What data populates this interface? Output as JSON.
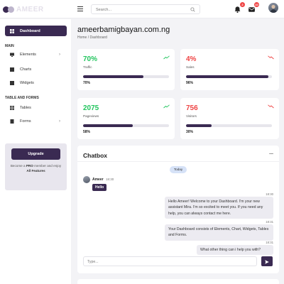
{
  "header": {
    "logo_text": "AMEER",
    "search_placeholder": "Search...",
    "notifications_count": "2",
    "messages_count": "10"
  },
  "sidebar": {
    "dashboard_label": "Dashboard",
    "main_section": "MAIN",
    "elements_label": "Elements",
    "charts_label": "Charts",
    "widgets_label": "Widgets",
    "tables_forms_section": "TABLE AND FORMS",
    "tables_label": "Tables",
    "forms_label": "Forms",
    "upgrade_button": "Upgrade",
    "upgrade_text_1": "Become a",
    "upgrade_text_pro": "PRO",
    "upgrade_text_2": "member and enjoy",
    "upgrade_text_all": "All Features"
  },
  "page": {
    "title": "ameerbamigbayan.com.ng",
    "breadcrumb": "Home / Dashboard"
  },
  "stats": [
    {
      "value": "70%",
      "label": "Traffic",
      "percent_label": "70%",
      "progress": 0.7,
      "trend": "up",
      "color": "#22c55e"
    },
    {
      "value": "4%",
      "label": "Sales",
      "percent_label": "96%",
      "progress": 0.96,
      "trend": "down",
      "color": "#ef4444"
    },
    {
      "value": "2075",
      "label": "Pageviews",
      "percent_label": "58%",
      "progress": 0.58,
      "trend": "up",
      "color": "#22c55e"
    },
    {
      "value": "756",
      "label": "Visitors",
      "percent_label": "30%",
      "progress": 0.3,
      "trend": "down",
      "color": "#ef4444"
    }
  ],
  "chat": {
    "title": "Chatbox",
    "more": "...",
    "date_chip": "Today",
    "sender_name": "Ameer",
    "sender_time": "18:30",
    "sender_message": "Hello",
    "replies": [
      {
        "time": "18:30",
        "text": "Hello Ameer! Welcome to your Dashboard. I'm your new assistant Mira. I'm so excited to meet you. If you need any help, you can always contact me here."
      },
      {
        "time": "18:31",
        "text": "Your Dashboard consists of Elements, Chart, Widgets, Tables and Forms."
      },
      {
        "time": "18:31",
        "text": "What other thing can i help you with?"
      }
    ],
    "input_placeholder": "Type..."
  },
  "colors": {
    "brand": "#3a2a52",
    "up": "#22c55e",
    "down": "#ef4444"
  }
}
